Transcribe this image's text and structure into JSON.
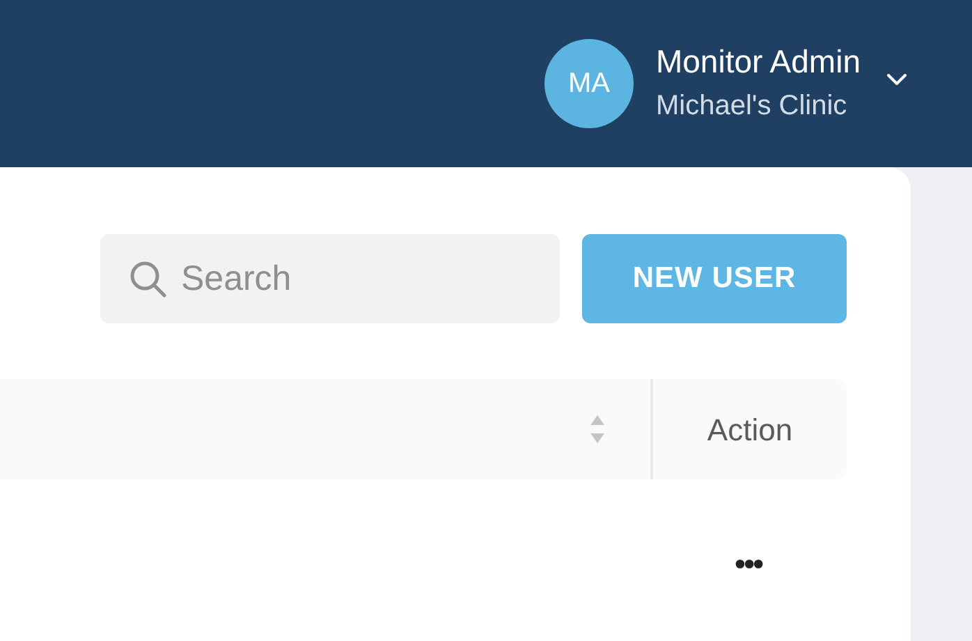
{
  "header": {
    "user": {
      "initials": "MA",
      "name": "Monitor Admin",
      "clinic": "Michael's Clinic"
    }
  },
  "toolbar": {
    "search": {
      "placeholder": "Search"
    },
    "button": "NEW USER"
  },
  "table": {
    "columns": [
      {
        "sortable": true
      },
      {
        "label": "Action",
        "sortable": false
      }
    ],
    "rows": [
      {
        "action": "•••"
      }
    ]
  }
}
